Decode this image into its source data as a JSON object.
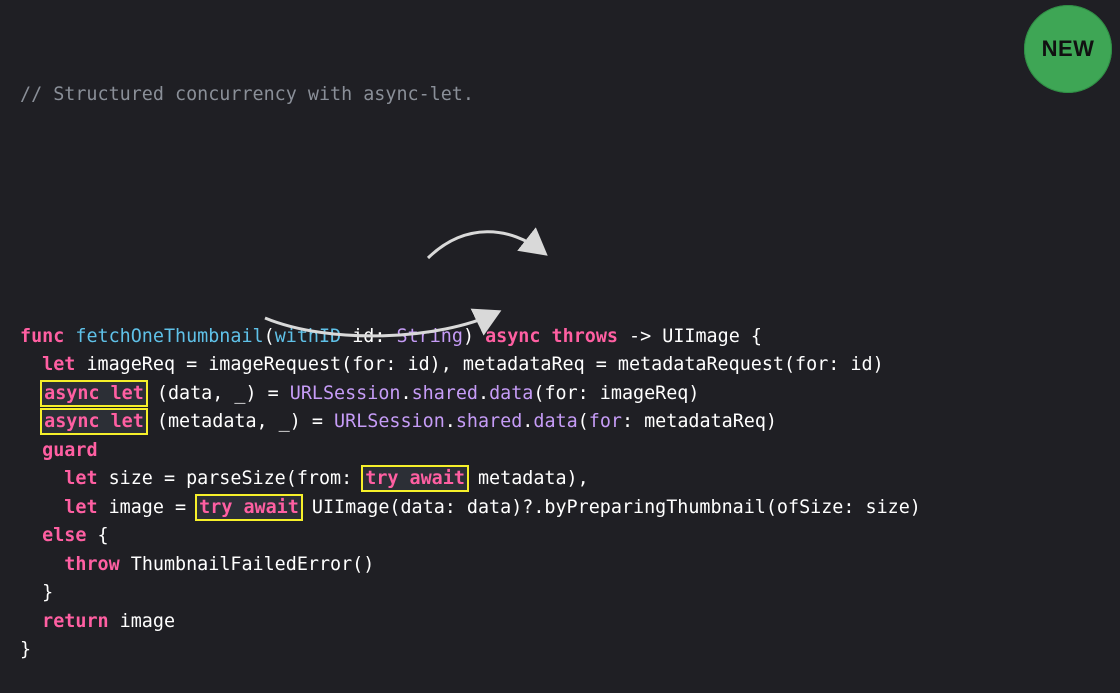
{
  "badge": {
    "label": "NEW",
    "color": "#3ea655"
  },
  "colors": {
    "background": "#1f1f24",
    "keyword": "#ff5fa2",
    "function": "#5fc1e8",
    "type": "#c69cf7",
    "comment": "#8a8f98",
    "highlight": "#f6f02a"
  },
  "code": {
    "comment": "// Structured concurrency with async-let.",
    "lines": [
      [
        {
          "t": "func",
          "c": "kw"
        },
        {
          "t": " ",
          "c": "plain"
        },
        {
          "t": "fetchOneThumbnail",
          "c": "fn"
        },
        {
          "t": "(",
          "c": "plain"
        },
        {
          "t": "withID",
          "c": "fn"
        },
        {
          "t": " id: ",
          "c": "plain"
        },
        {
          "t": "String",
          "c": "type"
        },
        {
          "t": ") ",
          "c": "plain"
        },
        {
          "t": "async",
          "c": "kw"
        },
        {
          "t": " ",
          "c": "plain"
        },
        {
          "t": "throws",
          "c": "kw"
        },
        {
          "t": " -> UIImage {",
          "c": "plain"
        }
      ],
      [
        {
          "t": "  ",
          "c": "plain"
        },
        {
          "t": "let",
          "c": "kw"
        },
        {
          "t": " imageReq = imageRequest(for: id), metadataReq = metadataRequest(for: id)",
          "c": "plain"
        }
      ],
      [
        {
          "t": "  ",
          "c": "plain"
        },
        {
          "t": "async let",
          "c": "kw",
          "hl": true,
          "name": "async-let-highlight-1"
        },
        {
          "t": " (data, _) = ",
          "c": "plain"
        },
        {
          "t": "URLSession",
          "c": "type"
        },
        {
          "t": ".",
          "c": "plain"
        },
        {
          "t": "shared",
          "c": "type"
        },
        {
          "t": ".",
          "c": "plain"
        },
        {
          "t": "data",
          "c": "type"
        },
        {
          "t": "(for: imageReq)",
          "c": "plain"
        }
      ],
      [
        {
          "t": "  ",
          "c": "plain"
        },
        {
          "t": "async let",
          "c": "kw",
          "hl": true,
          "name": "async-let-highlight-2"
        },
        {
          "t": " (metadata, _) = ",
          "c": "plain"
        },
        {
          "t": "URLSession",
          "c": "type"
        },
        {
          "t": ".",
          "c": "plain"
        },
        {
          "t": "shared",
          "c": "type"
        },
        {
          "t": ".",
          "c": "plain"
        },
        {
          "t": "data",
          "c": "type"
        },
        {
          "t": "(",
          "c": "plain"
        },
        {
          "t": "for",
          "c": "type"
        },
        {
          "t": ": metadataReq)",
          "c": "plain"
        }
      ],
      [
        {
          "t": "  ",
          "c": "plain"
        },
        {
          "t": "guard",
          "c": "kw"
        }
      ],
      [
        {
          "t": "    ",
          "c": "plain"
        },
        {
          "t": "let",
          "c": "kw"
        },
        {
          "t": " size = parseSize(from: ",
          "c": "plain"
        },
        {
          "t": "try await",
          "c": "kw",
          "hl": true,
          "name": "try-await-highlight-1"
        },
        {
          "t": " metadata),",
          "c": "plain"
        }
      ],
      [
        {
          "t": "    ",
          "c": "plain"
        },
        {
          "t": "let",
          "c": "kw"
        },
        {
          "t": " image = ",
          "c": "plain"
        },
        {
          "t": "try await",
          "c": "kw",
          "hl": true,
          "name": "try-await-highlight-2"
        },
        {
          "t": " UIImage(data: data)?.byPreparingThumbnail(ofSize: size)",
          "c": "plain"
        }
      ],
      [
        {
          "t": "  ",
          "c": "plain"
        },
        {
          "t": "else",
          "c": "kw"
        },
        {
          "t": " {",
          "c": "plain"
        }
      ],
      [
        {
          "t": "    ",
          "c": "plain"
        },
        {
          "t": "throw",
          "c": "kw"
        },
        {
          "t": " ThumbnailFailedError()",
          "c": "plain"
        }
      ],
      [
        {
          "t": "  }",
          "c": "plain"
        }
      ],
      [
        {
          "t": "  ",
          "c": "plain"
        },
        {
          "t": "return",
          "c": "kw"
        },
        {
          "t": " image",
          "c": "plain"
        }
      ],
      [
        {
          "t": "}",
          "c": "plain"
        }
      ]
    ]
  }
}
